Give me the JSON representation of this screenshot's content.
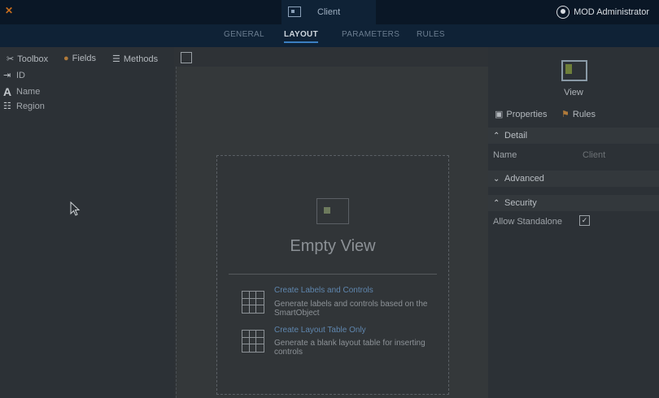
{
  "window": {
    "title": "Client",
    "user": "MOD Administrator"
  },
  "tabs": [
    "GENERAL",
    "LAYOUT",
    "PARAMETERS",
    "RULES"
  ],
  "left_panel": {
    "tabs": [
      {
        "label": "Toolbox",
        "icon": "toolbox-icon"
      },
      {
        "label": "Fields",
        "icon": "fields-icon"
      },
      {
        "label": "Methods",
        "icon": "methods-icon"
      }
    ],
    "fields": [
      {
        "label": "ID",
        "icon": "id-field-icon"
      },
      {
        "label": "Name",
        "icon": "text-field-icon"
      },
      {
        "label": "Region",
        "icon": "list-field-icon"
      }
    ]
  },
  "empty_view": {
    "title": "Empty View",
    "options": [
      {
        "title": "Create Labels and Controls",
        "description": "Generate labels and controls based on the SmartObject"
      },
      {
        "title": "Create Layout Table Only",
        "description": "Generate a blank layout table for inserting controls"
      }
    ]
  },
  "right_panel": {
    "item_label": "View",
    "tabs": [
      {
        "label": "Properties",
        "icon": "properties-icon"
      },
      {
        "label": "Rules",
        "icon": "rules-icon"
      }
    ],
    "sections": {
      "detail": {
        "title": "Detail",
        "name_label": "Name",
        "name_value": "Client"
      },
      "advanced": {
        "title": "Advanced"
      },
      "security": {
        "title": "Security",
        "allow_standalone_label": "Allow Standalone",
        "allow_standalone_checked": true
      }
    }
  },
  "colors": {
    "topbar": "#0a1726",
    "tabbar": "#0f2236",
    "accent": "#3b7fc1",
    "link": "#5f86ae"
  }
}
